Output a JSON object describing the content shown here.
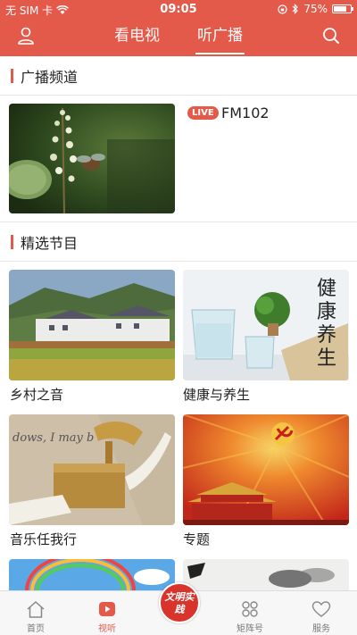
{
  "status_bar": {
    "carrier": "无 SIM 卡",
    "time": "09:05",
    "battery": "75%",
    "battery_level": 0.75
  },
  "header": {
    "tabs": [
      {
        "label": "看电视",
        "active": false
      },
      {
        "label": "听广播",
        "active": true
      }
    ]
  },
  "sections": {
    "channels_title": "广播频道",
    "featured_title": "精选节目"
  },
  "channel": {
    "badge": "LIVE",
    "name": "FM102"
  },
  "programs": [
    {
      "title": "乡村之音"
    },
    {
      "title": "健康与养生"
    },
    {
      "title": "音乐任我行"
    },
    {
      "title": "专题"
    }
  ],
  "thumb_text": {
    "health": [
      "健",
      "康",
      "养",
      "生"
    ],
    "music": "dows, I may b",
    "center_btn": "文明实践"
  },
  "tabbar": {
    "items": [
      {
        "label": "首页",
        "icon": "home-icon"
      },
      {
        "label": "视听",
        "icon": "play-icon"
      },
      {
        "label": "矩阵号",
        "icon": "grid-icon"
      },
      {
        "label": "服务",
        "icon": "heart-icon"
      }
    ]
  },
  "colors": {
    "accent": "#e35a4b"
  }
}
